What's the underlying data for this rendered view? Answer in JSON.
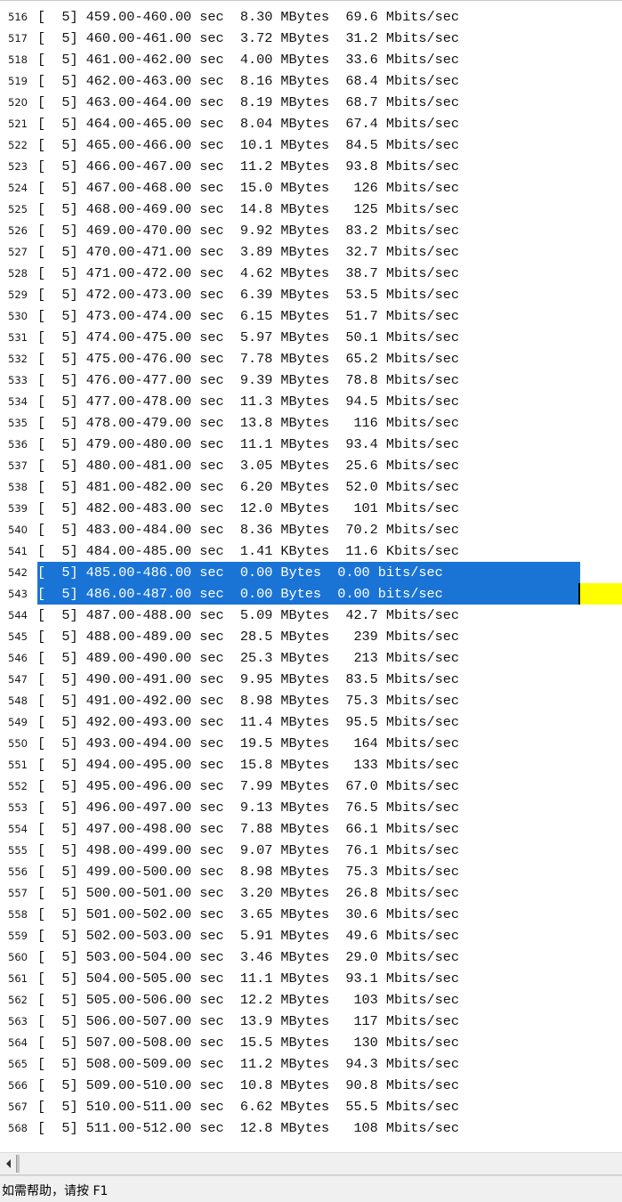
{
  "editor": {
    "lines": [
      {
        "num": "516",
        "text": "[  5] 459.00-460.00 sec  8.30 MBytes  69.6 Mbits/sec"
      },
      {
        "num": "517",
        "text": "[  5] 460.00-461.00 sec  3.72 MBytes  31.2 Mbits/sec"
      },
      {
        "num": "518",
        "text": "[  5] 461.00-462.00 sec  4.00 MBytes  33.6 Mbits/sec"
      },
      {
        "num": "519",
        "text": "[  5] 462.00-463.00 sec  8.16 MBytes  68.4 Mbits/sec"
      },
      {
        "num": "520",
        "text": "[  5] 463.00-464.00 sec  8.19 MBytes  68.7 Mbits/sec"
      },
      {
        "num": "521",
        "text": "[  5] 464.00-465.00 sec  8.04 MBytes  67.4 Mbits/sec"
      },
      {
        "num": "522",
        "text": "[  5] 465.00-466.00 sec  10.1 MBytes  84.5 Mbits/sec"
      },
      {
        "num": "523",
        "text": "[  5] 466.00-467.00 sec  11.2 MBytes  93.8 Mbits/sec"
      },
      {
        "num": "524",
        "text": "[  5] 467.00-468.00 sec  15.0 MBytes   126 Mbits/sec"
      },
      {
        "num": "525",
        "text": "[  5] 468.00-469.00 sec  14.8 MBytes   125 Mbits/sec"
      },
      {
        "num": "526",
        "text": "[  5] 469.00-470.00 sec  9.92 MBytes  83.2 Mbits/sec"
      },
      {
        "num": "527",
        "text": "[  5] 470.00-471.00 sec  3.89 MBytes  32.7 Mbits/sec"
      },
      {
        "num": "528",
        "text": "[  5] 471.00-472.00 sec  4.62 MBytes  38.7 Mbits/sec"
      },
      {
        "num": "529",
        "text": "[  5] 472.00-473.00 sec  6.39 MBytes  53.5 Mbits/sec"
      },
      {
        "num": "530",
        "text": "[  5] 473.00-474.00 sec  6.15 MBytes  51.7 Mbits/sec"
      },
      {
        "num": "531",
        "text": "[  5] 474.00-475.00 sec  5.97 MBytes  50.1 Mbits/sec"
      },
      {
        "num": "532",
        "text": "[  5] 475.00-476.00 sec  7.78 MBytes  65.2 Mbits/sec"
      },
      {
        "num": "533",
        "text": "[  5] 476.00-477.00 sec  9.39 MBytes  78.8 Mbits/sec"
      },
      {
        "num": "534",
        "text": "[  5] 477.00-478.00 sec  11.3 MBytes  94.5 Mbits/sec"
      },
      {
        "num": "535",
        "text": "[  5] 478.00-479.00 sec  13.8 MBytes   116 Mbits/sec"
      },
      {
        "num": "536",
        "text": "[  5] 479.00-480.00 sec  11.1 MBytes  93.4 Mbits/sec"
      },
      {
        "num": "537",
        "text": "[  5] 480.00-481.00 sec  3.05 MBytes  25.6 Mbits/sec"
      },
      {
        "num": "538",
        "text": "[  5] 481.00-482.00 sec  6.20 MBytes  52.0 Mbits/sec"
      },
      {
        "num": "539",
        "text": "[  5] 482.00-483.00 sec  12.0 MBytes   101 Mbits/sec"
      },
      {
        "num": "540",
        "text": "[  5] 483.00-484.00 sec  8.36 MBytes  70.2 Mbits/sec"
      },
      {
        "num": "541",
        "text": "[  5] 484.00-485.00 sec  1.41 KBytes  11.6 Kbits/sec"
      },
      {
        "num": "542",
        "text": "[  5] 485.00-486.00 sec  0.00 Bytes  0.00 bits/sec",
        "selected": true
      },
      {
        "num": "543",
        "text": "[  5] 486.00-487.00 sec  0.00 Bytes  0.00 bits/sec",
        "selected": true
      },
      {
        "num": "544",
        "text": "[  5] 487.00-488.00 sec  5.09 MBytes  42.7 Mbits/sec"
      },
      {
        "num": "545",
        "text": "[  5] 488.00-489.00 sec  28.5 MBytes   239 Mbits/sec"
      },
      {
        "num": "546",
        "text": "[  5] 489.00-490.00 sec  25.3 MBytes   213 Mbits/sec"
      },
      {
        "num": "547",
        "text": "[  5] 490.00-491.00 sec  9.95 MBytes  83.5 Mbits/sec"
      },
      {
        "num": "548",
        "text": "[  5] 491.00-492.00 sec  8.98 MBytes  75.3 Mbits/sec"
      },
      {
        "num": "549",
        "text": "[  5] 492.00-493.00 sec  11.4 MBytes  95.5 Mbits/sec"
      },
      {
        "num": "550",
        "text": "[  5] 493.00-494.00 sec  19.5 MBytes   164 Mbits/sec"
      },
      {
        "num": "551",
        "text": "[  5] 494.00-495.00 sec  15.8 MBytes   133 Mbits/sec"
      },
      {
        "num": "552",
        "text": "[  5] 495.00-496.00 sec  7.99 MBytes  67.0 Mbits/sec"
      },
      {
        "num": "553",
        "text": "[  5] 496.00-497.00 sec  9.13 MBytes  76.5 Mbits/sec"
      },
      {
        "num": "554",
        "text": "[  5] 497.00-498.00 sec  7.88 MBytes  66.1 Mbits/sec"
      },
      {
        "num": "555",
        "text": "[  5] 498.00-499.00 sec  9.07 MBytes  76.1 Mbits/sec"
      },
      {
        "num": "556",
        "text": "[  5] 499.00-500.00 sec  8.98 MBytes  75.3 Mbits/sec"
      },
      {
        "num": "557",
        "text": "[  5] 500.00-501.00 sec  3.20 MBytes  26.8 Mbits/sec"
      },
      {
        "num": "558",
        "text": "[  5] 501.00-502.00 sec  3.65 MBytes  30.6 Mbits/sec"
      },
      {
        "num": "559",
        "text": "[  5] 502.00-503.00 sec  5.91 MBytes  49.6 Mbits/sec"
      },
      {
        "num": "560",
        "text": "[  5] 503.00-504.00 sec  3.46 MBytes  29.0 Mbits/sec"
      },
      {
        "num": "561",
        "text": "[  5] 504.00-505.00 sec  11.1 MBytes  93.1 Mbits/sec"
      },
      {
        "num": "562",
        "text": "[  5] 505.00-506.00 sec  12.2 MBytes   103 Mbits/sec"
      },
      {
        "num": "563",
        "text": "[  5] 506.00-507.00 sec  13.9 MBytes   117 Mbits/sec"
      },
      {
        "num": "564",
        "text": "[  5] 507.00-508.00 sec  15.5 MBytes   130 Mbits/sec"
      },
      {
        "num": "565",
        "text": "[  5] 508.00-509.00 sec  11.2 MBytes  94.3 Mbits/sec"
      },
      {
        "num": "566",
        "text": "[  5] 509.00-510.00 sec  10.8 MBytes  90.8 Mbits/sec"
      },
      {
        "num": "567",
        "text": "[  5] 510.00-511.00 sec  6.62 MBytes  55.5 Mbits/sec"
      },
      {
        "num": "568",
        "text": "[  5] 511.00-512.00 sec  12.8 MBytes   108 Mbits/sec"
      }
    ],
    "selection_color": "#1a74d6",
    "caret_marker_color": "#ffff00"
  },
  "scrollbar": {
    "left_arrow_icon": "triangle-left-icon"
  },
  "status_bar": {
    "text": "如需帮助，请按 F1"
  }
}
